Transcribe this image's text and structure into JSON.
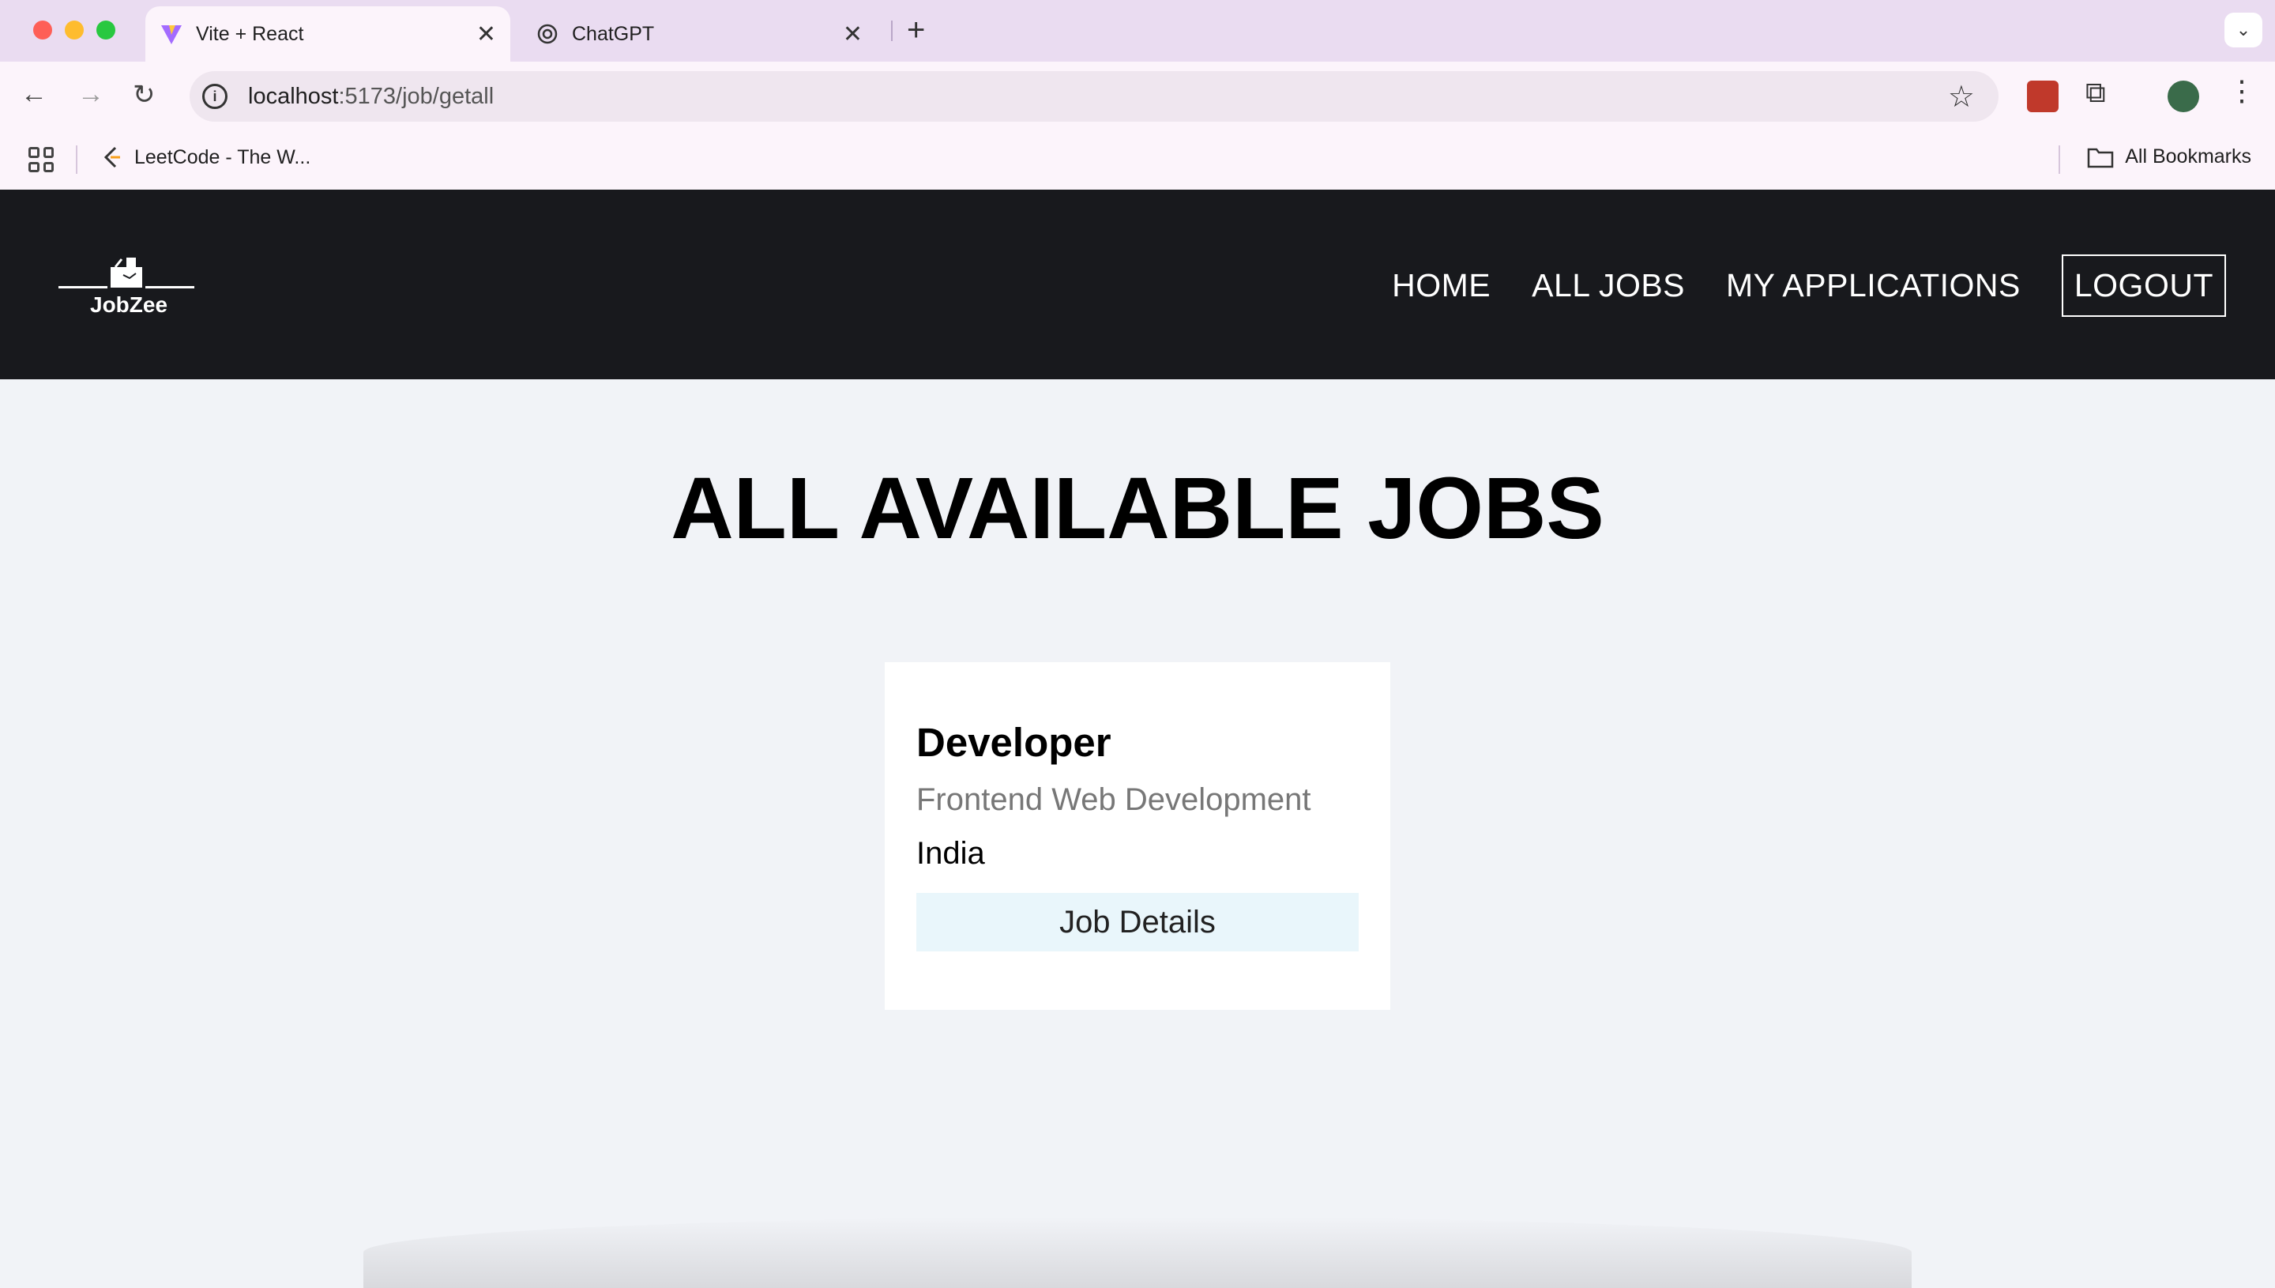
{
  "browser": {
    "tabs": [
      {
        "title": "Vite + React",
        "active": true,
        "favicon": "vite-icon"
      },
      {
        "title": "ChatGPT",
        "active": false,
        "favicon": "chatgpt-icon"
      }
    ],
    "url_host": "localhost",
    "url_path": ":5173/job/getall",
    "bookmarks": [
      {
        "label": "LeetCode - The W..."
      }
    ],
    "all_bookmarks_label": "All Bookmarks"
  },
  "header": {
    "brand": "JobZee",
    "nav": {
      "home": "HOME",
      "all_jobs": "ALL JOBS",
      "my_applications": "MY APPLICATIONS",
      "logout": "LOGOUT"
    }
  },
  "main": {
    "title": "ALL AVAILABLE JOBS",
    "jobs": [
      {
        "title": "Developer",
        "category": "Frontend Web Development",
        "country": "India",
        "button": "Job Details"
      }
    ]
  },
  "colors": {
    "header_bg": "#18191d",
    "page_bg": "#f1f3f7",
    "button_bg": "#e9f6fb"
  }
}
